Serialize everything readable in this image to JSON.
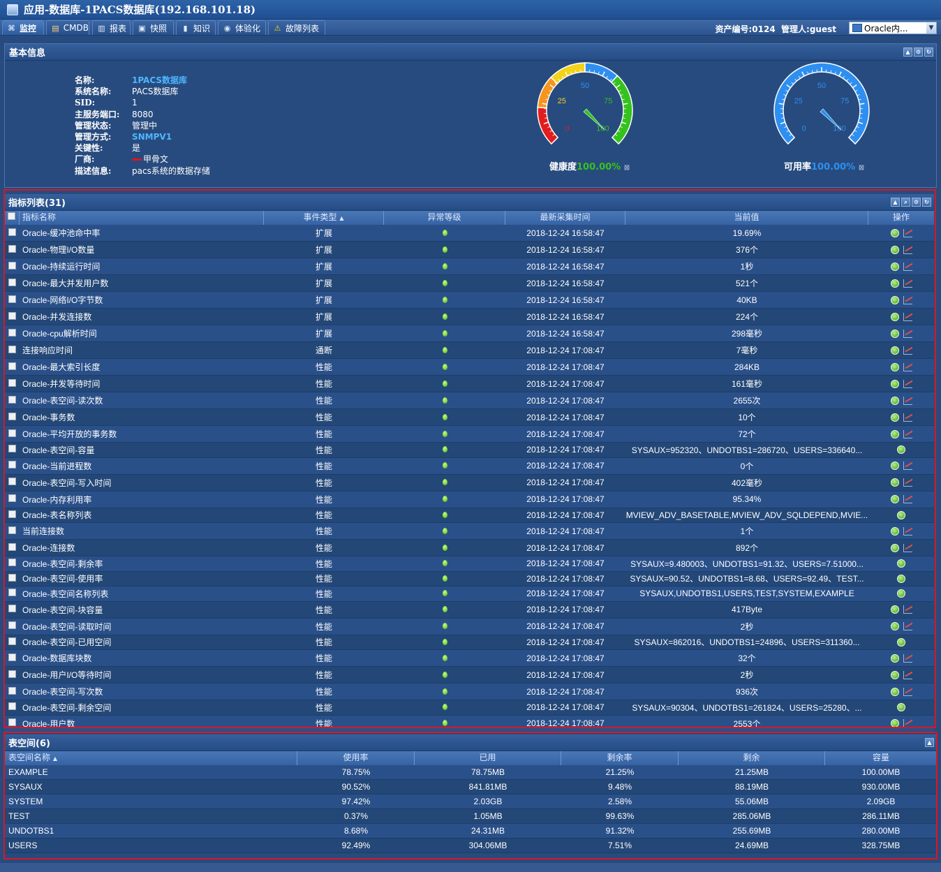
{
  "title": "应用-数据库-1PACS数据库(192.168.101.18)",
  "tabs": [
    {
      "label": "监控",
      "icon": "binoculars-icon"
    },
    {
      "label": "CMDB",
      "icon": "database-icon"
    },
    {
      "label": "报表",
      "icon": "bar-chart-icon"
    },
    {
      "label": "快照",
      "icon": "camera-icon"
    },
    {
      "label": "知识",
      "icon": "book-icon"
    },
    {
      "label": "体验化",
      "icon": "user-icon"
    },
    {
      "label": "故障列表",
      "icon": "warning-icon"
    }
  ],
  "asset": {
    "number_label": "资产编号:0124",
    "manager_label": "管理人:guest"
  },
  "selector": {
    "value": "Oracle内..."
  },
  "basic": {
    "title": "基本信息",
    "rows": [
      {
        "k": "名称:",
        "v": "1PACS数据库",
        "link": true
      },
      {
        "k": "系统名称:",
        "v": "PACS数据库"
      },
      {
        "k": "SID:",
        "v": "1"
      },
      {
        "k": "主服务端口:",
        "v": "8080"
      },
      {
        "k": "管理状态:",
        "v": "管理中"
      },
      {
        "k": "管理方式:",
        "v": "SNMPV1",
        "link": true
      },
      {
        "k": "关键性:",
        "v": "是"
      },
      {
        "k": "厂商:",
        "v": "甲骨文"
      },
      {
        "k": "描述信息:",
        "v": "pacs系统的数据存储"
      }
    ],
    "gauges": [
      {
        "label": "健康度",
        "value_text": "100.00%",
        "value": 100,
        "ticks": [
          "0",
          "25",
          "50",
          "75",
          "100"
        ],
        "color": "#35c21d"
      },
      {
        "label": "可用率",
        "value_text": "100.00%",
        "value": 100,
        "ticks": [
          "0",
          "25",
          "50",
          "75",
          "100"
        ],
        "color": "#2e8ff0"
      }
    ]
  },
  "metrics": {
    "title": "指标列表(31)",
    "columns": [
      "指标名称",
      "事件类型",
      "异常等级",
      "最新采集时间",
      "当前值",
      "操作"
    ],
    "rows": [
      {
        "name": "Oracle-缓冲池命中率",
        "type": "扩展",
        "time": "2018-12-24 16:58:47",
        "value": "19.69%",
        "chart": true
      },
      {
        "name": "Oracle-物理I/O数量",
        "type": "扩展",
        "time": "2018-12-24 16:58:47",
        "value": "376个",
        "chart": true
      },
      {
        "name": "Oracle-持续运行时间",
        "type": "扩展",
        "time": "2018-12-24 16:58:47",
        "value": "1秒",
        "chart": true
      },
      {
        "name": "Oracle-最大并发用户数",
        "type": "扩展",
        "time": "2018-12-24 16:58:47",
        "value": "521个",
        "chart": true
      },
      {
        "name": "Oracle-网络I/O字节数",
        "type": "扩展",
        "time": "2018-12-24 16:58:47",
        "value": "40KB",
        "chart": true
      },
      {
        "name": "Oracle-并发连接数",
        "type": "扩展",
        "time": "2018-12-24 16:58:47",
        "value": "224个",
        "chart": true
      },
      {
        "name": "Oracle-cpu解析时间",
        "type": "扩展",
        "time": "2018-12-24 16:58:47",
        "value": "298毫秒",
        "chart": true
      },
      {
        "name": "连接响应时间",
        "type": "通断",
        "time": "2018-12-24 17:08:47",
        "value": "7毫秒",
        "chart": true
      },
      {
        "name": "Oracle-最大索引长度",
        "type": "性能",
        "time": "2018-12-24 17:08:47",
        "value": "284KB",
        "chart": true
      },
      {
        "name": "Oracle-并发等待时间",
        "type": "性能",
        "time": "2018-12-24 17:08:47",
        "value": "161毫秒",
        "chart": true
      },
      {
        "name": "Oracle-表空间-读次数",
        "type": "性能",
        "time": "2018-12-24 17:08:47",
        "value": "2655次",
        "chart": true
      },
      {
        "name": "Oracle-事务数",
        "type": "性能",
        "time": "2018-12-24 17:08:47",
        "value": "10个",
        "chart": true
      },
      {
        "name": "Oracle-平均开放的事务数",
        "type": "性能",
        "time": "2018-12-24 17:08:47",
        "value": "72个",
        "chart": true
      },
      {
        "name": "Oracle-表空间-容量",
        "type": "性能",
        "time": "2018-12-24 17:08:47",
        "value": "SYSAUX=952320、UNDOTBS1=286720、USERS=336640...",
        "chart": false
      },
      {
        "name": "Oracle-当前进程数",
        "type": "性能",
        "time": "2018-12-24 17:08:47",
        "value": "0个",
        "chart": true
      },
      {
        "name": "Oracle-表空间-写入时间",
        "type": "性能",
        "time": "2018-12-24 17:08:47",
        "value": "402毫秒",
        "chart": true
      },
      {
        "name": "Oracle-内存利用率",
        "type": "性能",
        "time": "2018-12-24 17:08:47",
        "value": "95.34%",
        "chart": true
      },
      {
        "name": "Oracle-表名称列表",
        "type": "性能",
        "time": "2018-12-24 17:08:47",
        "value": "MVIEW_ADV_BASETABLE,MVIEW_ADV_SQLDEPEND,MVIE...",
        "chart": false
      },
      {
        "name": "当前连接数",
        "type": "性能",
        "time": "2018-12-24 17:08:47",
        "value": "1个",
        "chart": true
      },
      {
        "name": "Oracle-连接数",
        "type": "性能",
        "time": "2018-12-24 17:08:47",
        "value": "892个",
        "chart": true
      },
      {
        "name": "Oracle-表空间-剩余率",
        "type": "性能",
        "time": "2018-12-24 17:08:47",
        "value": "SYSAUX=9.480003、UNDOTBS1=91.32、USERS=7.51000...",
        "chart": false
      },
      {
        "name": "Oracle-表空间-使用率",
        "type": "性能",
        "time": "2018-12-24 17:08:47",
        "value": "SYSAUX=90.52、UNDOTBS1=8.68、USERS=92.49、TEST...",
        "chart": false
      },
      {
        "name": "Oracle-表空间名称列表",
        "type": "性能",
        "time": "2018-12-24 17:08:47",
        "value": "SYSAUX,UNDOTBS1,USERS,TEST,SYSTEM,EXAMPLE",
        "chart": false
      },
      {
        "name": "Oracle-表空间-块容量",
        "type": "性能",
        "time": "2018-12-24 17:08:47",
        "value": "417Byte",
        "chart": true
      },
      {
        "name": "Oracle-表空间-读取时间",
        "type": "性能",
        "time": "2018-12-24 17:08:47",
        "value": "2秒",
        "chart": true
      },
      {
        "name": "Oracle-表空间-已用空间",
        "type": "性能",
        "time": "2018-12-24 17:08:47",
        "value": "SYSAUX=862016、UNDOTBS1=24896、USERS=311360...",
        "chart": false
      },
      {
        "name": "Oracle-数据库块数",
        "type": "性能",
        "time": "2018-12-24 17:08:47",
        "value": "32个",
        "chart": true
      },
      {
        "name": "Oracle-用户I/O等待时间",
        "type": "性能",
        "time": "2018-12-24 17:08:47",
        "value": "2秒",
        "chart": true
      },
      {
        "name": "Oracle-表空间-写次数",
        "type": "性能",
        "time": "2018-12-24 17:08:47",
        "value": "936次",
        "chart": true
      },
      {
        "name": "Oracle-表空间-剩余空间",
        "type": "性能",
        "time": "2018-12-24 17:08:47",
        "value": "SYSAUX=90304、UNDOTBS1=261824、USERS=25280、...",
        "chart": false
      },
      {
        "name": "Oracle-用户数",
        "type": "性能",
        "time": "2018-12-24 17:08:47",
        "value": "2553个",
        "chart": true
      }
    ]
  },
  "tablespaces": {
    "title": "表空间(6)",
    "columns": [
      "表空间名称",
      "使用率",
      "已用",
      "剩余率",
      "剩余",
      "容量"
    ],
    "rows": [
      [
        "EXAMPLE",
        "78.75%",
        "78.75MB",
        "21.25%",
        "21.25MB",
        "100.00MB"
      ],
      [
        "SYSAUX",
        "90.52%",
        "841.81MB",
        "9.48%",
        "88.19MB",
        "930.00MB"
      ],
      [
        "SYSTEM",
        "97.42%",
        "2.03GB",
        "2.58%",
        "55.06MB",
        "2.09GB"
      ],
      [
        "TEST",
        "0.37%",
        "1.05MB",
        "99.63%",
        "285.06MB",
        "286.11MB"
      ],
      [
        "UNDOTBS1",
        "8.68%",
        "24.31MB",
        "91.32%",
        "255.69MB",
        "280.00MB"
      ],
      [
        "USERS",
        "92.49%",
        "304.06MB",
        "7.51%",
        "24.69MB",
        "328.75MB"
      ]
    ]
  }
}
